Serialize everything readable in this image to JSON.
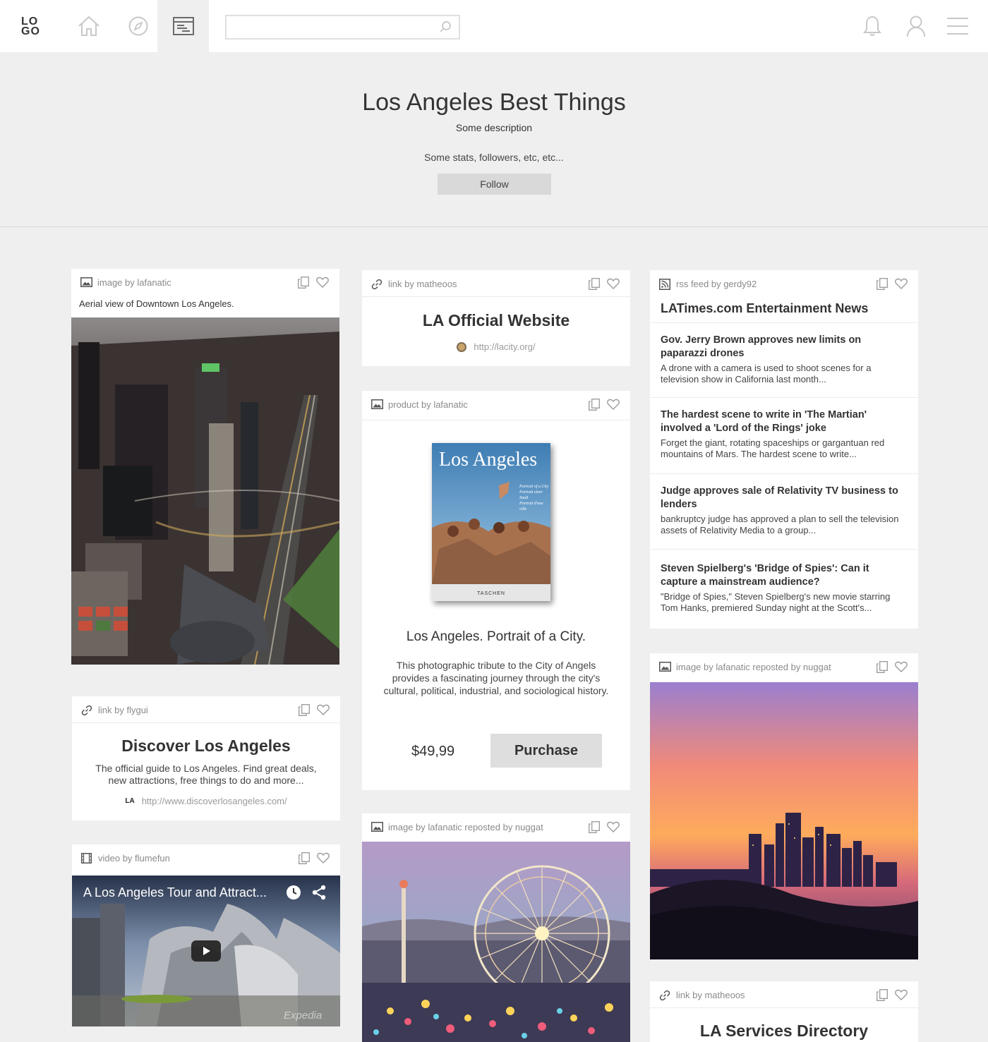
{
  "nav": {
    "logo_line1": "LO",
    "logo_line2": "GO",
    "home_icon": "home-icon",
    "explore_icon": "compass-icon",
    "collections_icon": "collection-icon",
    "search": {
      "value": "",
      "placeholder": "",
      "icon": "search-icon"
    },
    "bell_icon": "bell-icon",
    "user_icon": "user-icon",
    "menu_icon": "menu-icon"
  },
  "collection": {
    "title": "Los Angeles Best Things",
    "description": "Some description",
    "stats": "Some stats, followers, etc, etc...",
    "follow_label": "Follow"
  },
  "cards": {
    "aerial": {
      "meta": "image by lafanatic",
      "caption": "Aerial view of Downtown Los Angeles."
    },
    "discover": {
      "meta": "link by flygui",
      "title": "Discover Los Angeles",
      "description": "The official guide to Los Angeles. Find great deals, new attractions, free things to do and more...",
      "favicon_label": "LA",
      "url": "http://www.discoverlosangeles.com/"
    },
    "video": {
      "meta": "video by flumefun",
      "title": "A Los Angeles Tour and Attract...",
      "watermark": "Expedia"
    },
    "official": {
      "meta": "link by matheoos",
      "title": "LA Official Website",
      "url": "http://lacity.org/"
    },
    "product": {
      "meta": "product by lafanatic",
      "book_title": "Los Angeles",
      "book_subtitle": "Portrait of a City\nPortrait einer Stadt\nPortrait d'une ville",
      "book_publisher": "TASCHEN",
      "title": "Los Angeles. Portrait of a City.",
      "description": "This photographic tribute to the City of Angels provides a fascinating journey through the city's cultural, political, industrial, and sociological history.",
      "price": "$49,99",
      "purchase_label": "Purchase"
    },
    "ferris": {
      "meta": "image by lafanatic reposted by nuggat"
    },
    "rss": {
      "meta": "rss feed by gerdy92",
      "title": "LATimes.com Entertainment News",
      "items": [
        {
          "headline": "Gov. Jerry Brown approves new limits on paparazzi drones",
          "summary": "A drone with a camera is used to shoot scenes for a television show in California last month..."
        },
        {
          "headline": "The hardest scene to write in 'The Martian' involved a 'Lord of the Rings' joke",
          "summary": "Forget the giant, rotating spaceships or gargantuan red mountains of Mars. The hardest scene to write..."
        },
        {
          "headline": "Judge approves sale of Relativity TV business to lenders",
          "summary": " bankruptcy judge has approved a plan to sell the television assets of Relativity Media to a group..."
        },
        {
          "headline": "Steven Spielberg's 'Bridge of Spies': Can it capture a mainstream audience?",
          "summary": "\"Bridge of Spies,\" Steven Spielberg's new movie starring Tom Hanks, premiered Sunday night at the Scott's..."
        }
      ]
    },
    "sunset": {
      "meta": "image by lafanatic reposted by nuggat"
    },
    "services": {
      "meta": "link by matheoos",
      "title": "LA Services Directory"
    }
  },
  "colors": {
    "page_bg": "#efefef",
    "card_bg": "#ffffff",
    "muted_text": "#8a8a8a",
    "button_gray": "#d9d9d9"
  }
}
